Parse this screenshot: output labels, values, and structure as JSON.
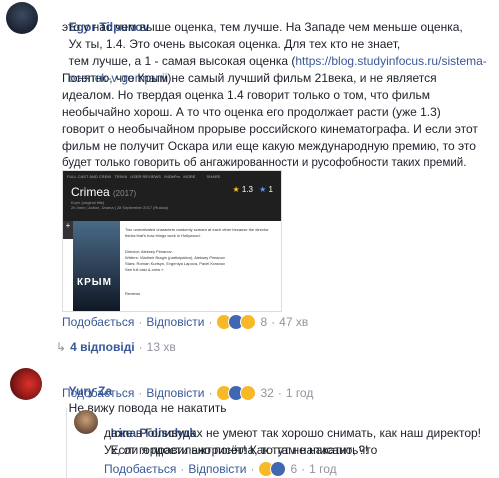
{
  "comment1": {
    "author": "Egor Tilpunov",
    "lines": [
      "Ух ты, 1.4. Это очень высокая оценка. Для тех кто не знает,",
      "это у нас чем выше оценка, тем лучше. На Западе чем меньше оценка,",
      "тем лучше, а 1 - самая высокая оценка (https://blog.studyinfocus.ru/sistema-",
      "ocenok-v-germanii).",
      "Понятно, что Крым не самый лучший фильм 21века, и не является",
      "идеалом. Но твердая оценка 1.4 говорит только о том, что фильм",
      "необычайно хорош. А то что оценка его продолжает расти (уже 1.3)",
      "говорит о необычайном прорыве российского кинематографа. И если этот",
      "фильм не получит Оскара или еще какую международную премию, то это",
      "будет только говорить об ангажированности и русофобности таких премий."
    ],
    "link_line1_prefix": "тем лучше, а 1 - самая высокая оценка (",
    "link_line1": "https://blog.studyinfocus.ru/sistema-",
    "link_line2": "ocenok-v-germanii",
    "link_line2_suffix": ").",
    "like_label": "Подобається",
    "reply_label": "Відповісти",
    "reaction_count": "8",
    "time": "47 хв",
    "replies_link": "4 відповіді",
    "replies_time": "13 хв"
  },
  "imdb": {
    "nav": "FULL CAST AND CREW   TRIVIA   USER REVIEWS   IMDbPro   MORE          SHARE",
    "title": "Crimea",
    "year": "(2017)",
    "sub": "Krym (original title)\n2h 4min | Action, Drama | 28 September 2017 (Russia)",
    "rating": "1.3",
    "rating2": "1",
    "add": "+",
    "poster_text": "КРЫМ",
    "desc": "Two unmotivated characters randomly scream at each other because the director thinks that's how things work in Hollywood.",
    "credits": "Director: Aleksey Pimanov\nWriters: Vladimir Bragin (participation), Aleksey Pimanov\nStars: Roman Kurtsyn, Evgeniya Lapova, Pavel Krasnov\nSee full cast & crew »",
    "reviews": "Reviews"
  },
  "comment2": {
    "author": "Yury Za",
    "text": "Не вижу повода не накатить",
    "like_label": "Подобається",
    "reply_label": "Відповісти",
    "reaction_count": "32",
    "time": "1 год"
  },
  "comment3": {
    "author": "Irina Polischuk",
    "lines": [
      "Если я правильно поняла, то там написано, что",
      "даже в Голивудах не умеют так хорошо снимать, как наш директор!",
      "Ух, от гордости ажтрисёт! Как тут не накатить?!"
    ],
    "like_label": "Подобається",
    "reply_label": "Відповісти",
    "reaction_count": "6",
    "time": "1 год"
  },
  "colors": {
    "link": "#385898",
    "meta": "#90949c",
    "like_blue": "#4267b2",
    "emoji_yellow": "#f7b928"
  },
  "icons": [
    "avatar-egor",
    "avatar-yury",
    "avatar-irina",
    "reply-arrow-icon",
    "laugh-reaction-icon",
    "like-reaction-icon",
    "wow-reaction-icon",
    "imdb-star-icon"
  ]
}
